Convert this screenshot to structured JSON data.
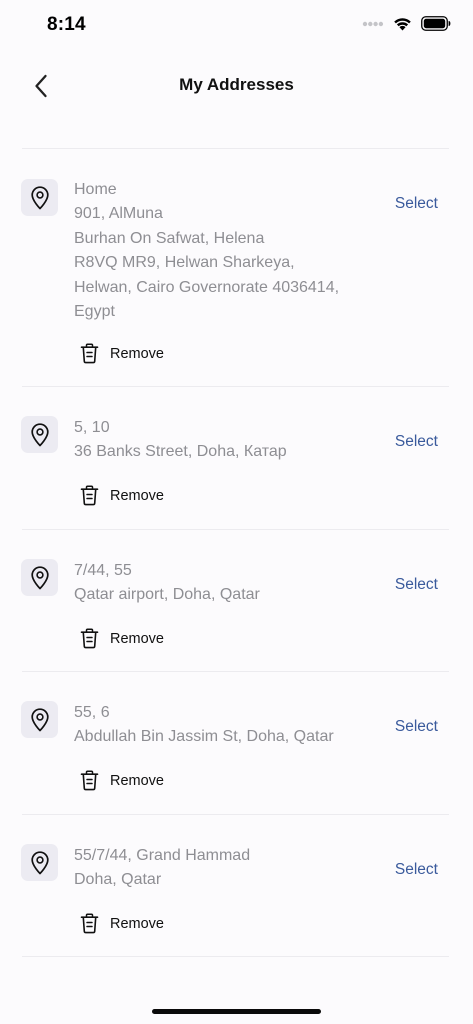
{
  "status_bar": {
    "time": "8:14"
  },
  "header": {
    "title": "My Addresses",
    "back_icon": "chevron-left-icon"
  },
  "addresses": [
    {
      "lines": [
        "Home",
        "901, AlMuna",
        "Burhan On Safwat, Helena",
        "R8VQ MR9,  Helwan Sharkeya,",
        "Helwan,  Cairo Governorate 4036414,",
        "Egypt"
      ],
      "select_label": "Select",
      "remove_label": "Remove"
    },
    {
      "lines": [
        "5, 10",
        "36 Banks Street, Doha, Катар"
      ],
      "select_label": "Select",
      "remove_label": "Remove"
    },
    {
      "lines": [
        "7/44, 55",
        "Qatar airport, Doha, Qatar"
      ],
      "select_label": "Select",
      "remove_label": "Remove"
    },
    {
      "lines": [
        "55, 6",
        "Abdullah Bin Jassim St,  Doha,  Qatar"
      ],
      "select_label": "Select",
      "remove_label": "Remove"
    },
    {
      "lines": [
        "55/7/44, Grand Hammad",
        "Doha, Qatar"
      ],
      "select_label": "Select",
      "remove_label": "Remove"
    }
  ],
  "colors": {
    "background": "#fcfbfd",
    "select_link": "#3a5a9c",
    "address_text": "#8e8e93",
    "pin_box": "#ecebf2"
  }
}
